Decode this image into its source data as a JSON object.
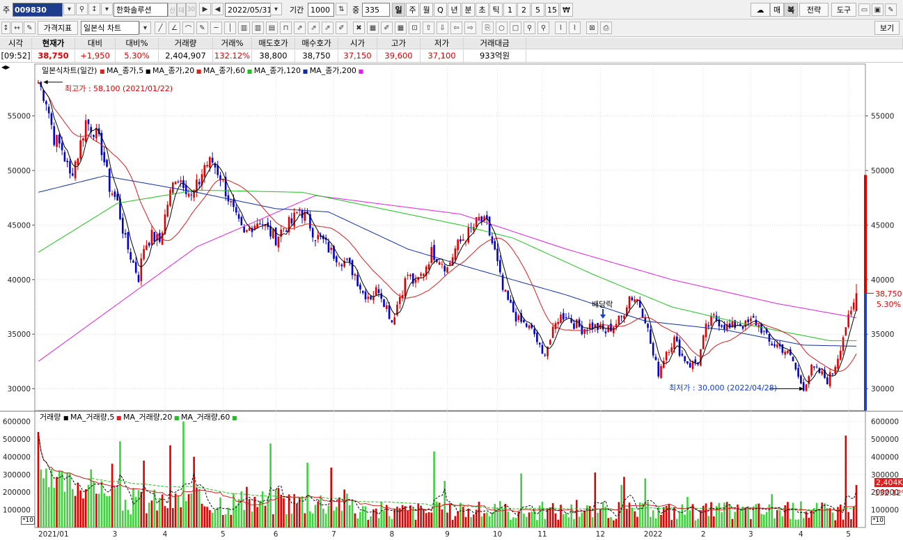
{
  "toolbar": {
    "market_label": "주",
    "stock_code": "009830",
    "stock_name": "한화솔루션",
    "badge1": "신",
    "badge2": "대",
    "badge3": "30",
    "date": "2022/05/31",
    "period_label": "기간",
    "period_value": "1000",
    "count_label": "중",
    "count_value": "335",
    "intervals": [
      "일",
      "주",
      "월",
      "Q",
      "년",
      "분",
      "초",
      "틱",
      "1",
      "2",
      "5",
      "15",
      "₩"
    ],
    "right_buttons": [
      "매",
      "복",
      "전략",
      "도구"
    ],
    "indicator_btn": "가격지표",
    "chart_type": "일본식 차트",
    "view_btn": "보기"
  },
  "quote": {
    "headers": [
      "시각",
      "현재가",
      "대비",
      "대비%",
      "거래량",
      "거래%",
      "매도호가",
      "매수호가",
      "시가",
      "고가",
      "저가",
      "거래대금"
    ],
    "values": [
      "[09:52]",
      "38,750",
      "+1,950",
      "5.30%",
      "2,404,907",
      "132.12%",
      "38,800",
      "38,750",
      "37,150",
      "39,600",
      "37,100",
      "933억원"
    ]
  },
  "price_panel": {
    "legend_title": "일본식차트(일간)",
    "ma": [
      {
        "label": "MA_종가,5",
        "color": "#e02020"
      },
      {
        "label": "MA_종가,20",
        "color": "#000000"
      },
      {
        "label": "MA_종가,60",
        "color": "#e02020"
      },
      {
        "label": "MA_종가,120",
        "color": "#20c020"
      },
      {
        "label": "MA_종가,200",
        "color": "#1030a0"
      }
    ],
    "ma_extra_color": "#e020e0",
    "high_note": "최고가 : 58,100 (2021/01/22)",
    "low_note": "최저가 : 30,000 (2022/04/28)",
    "dividend_note": "배당락",
    "last_price": "38,750",
    "last_pct": "5.30%"
  },
  "volume_panel": {
    "legend_title": "거래량",
    "ma": [
      {
        "label": "MA_거래량,5",
        "color": "#000000"
      },
      {
        "label": "MA_거래량,20",
        "color": "#e02020"
      },
      {
        "label": "MA_거래량,60",
        "color": "#20c020"
      }
    ],
    "last_volume": "2,404K",
    "last_pct": "132.12%",
    "scale_note": "*10"
  },
  "chart_data": {
    "type": "candlestick",
    "price_ylim": [
      28000,
      59500
    ],
    "price_ticks": [
      30000,
      35000,
      40000,
      45000,
      50000,
      55000
    ],
    "volume_ylim": [
      0,
      630000
    ],
    "volume_ticks": [
      100000,
      200000,
      300000,
      400000,
      500000,
      600000
    ],
    "x_ticks": [
      "2021/01",
      "3",
      "4",
      "5",
      "6",
      "7",
      "8",
      "9",
      "10",
      "11",
      "12",
      "2022",
      "2",
      "3",
      "4",
      "5"
    ],
    "price_anchors": [
      [
        0,
        58100
      ],
      [
        3,
        56500
      ],
      [
        6,
        53000
      ],
      [
        9,
        52000
      ],
      [
        12,
        49500
      ],
      [
        15,
        51500
      ],
      [
        18,
        54500
      ],
      [
        21,
        53800
      ],
      [
        24,
        52000
      ],
      [
        27,
        48500
      ],
      [
        30,
        47000
      ],
      [
        33,
        43500
      ],
      [
        36,
        41500
      ],
      [
        38,
        40200
      ],
      [
        40,
        43000
      ],
      [
        43,
        44000
      ],
      [
        46,
        43500
      ],
      [
        49,
        47000
      ],
      [
        52,
        49500
      ],
      [
        55,
        49000
      ],
      [
        58,
        47500
      ],
      [
        61,
        49000
      ],
      [
        63,
        50500
      ],
      [
        66,
        50800
      ],
      [
        69,
        49500
      ],
      [
        72,
        47500
      ],
      [
        75,
        45500
      ],
      [
        78,
        44000
      ],
      [
        81,
        45000
      ],
      [
        84,
        45500
      ],
      [
        87,
        44500
      ],
      [
        90,
        43800
      ],
      [
        93,
        44800
      ],
      [
        96,
        45200
      ],
      [
        99,
        46500
      ],
      [
        102,
        45500
      ],
      [
        105,
        44000
      ],
      [
        108,
        43500
      ],
      [
        111,
        42500
      ],
      [
        114,
        42000
      ],
      [
        117,
        41500
      ],
      [
        120,
        40500
      ],
      [
        123,
        38800
      ],
      [
        126,
        38500
      ],
      [
        129,
        39200
      ],
      [
        132,
        37500
      ],
      [
        134,
        36200
      ],
      [
        137,
        38500
      ],
      [
        140,
        40500
      ],
      [
        143,
        39500
      ],
      [
        146,
        40800
      ],
      [
        149,
        42500
      ],
      [
        152,
        42000
      ],
      [
        155,
        41000
      ],
      [
        158,
        42800
      ],
      [
        161,
        43800
      ],
      [
        164,
        44500
      ],
      [
        167,
        45500
      ],
      [
        170,
        45000
      ],
      [
        173,
        42500
      ],
      [
        176,
        39000
      ],
      [
        179,
        37500
      ],
      [
        182,
        36200
      ],
      [
        185,
        35800
      ],
      [
        188,
        35000
      ],
      [
        191,
        33000
      ],
      [
        194,
        34500
      ],
      [
        197,
        36500
      ],
      [
        200,
        36800
      ],
      [
        203,
        36000
      ],
      [
        206,
        35500
      ],
      [
        209,
        35800
      ],
      [
        212,
        35600
      ],
      [
        215,
        35200
      ],
      [
        218,
        35800
      ],
      [
        221,
        36500
      ],
      [
        224,
        38500
      ],
      [
        227,
        38200
      ],
      [
        230,
        36500
      ],
      [
        233,
        33000
      ],
      [
        235,
        31500
      ],
      [
        238,
        33500
      ],
      [
        241,
        34500
      ],
      [
        244,
        33000
      ],
      [
        247,
        32200
      ],
      [
        250,
        32500
      ],
      [
        253,
        35500
      ],
      [
        256,
        36500
      ],
      [
        259,
        36000
      ],
      [
        262,
        35500
      ],
      [
        265,
        36000
      ],
      [
        268,
        35800
      ],
      [
        271,
        36300
      ],
      [
        274,
        35500
      ],
      [
        277,
        34200
      ],
      [
        280,
        34000
      ],
      [
        283,
        33500
      ],
      [
        286,
        32500
      ],
      [
        288,
        31000
      ],
      [
        290,
        30200
      ],
      [
        293,
        31800
      ],
      [
        296,
        31500
      ],
      [
        299,
        30800
      ],
      [
        301,
        31500
      ],
      [
        303,
        33000
      ],
      [
        306,
        35800
      ],
      [
        308,
        36800
      ],
      [
        310,
        38750
      ]
    ],
    "ma200_anchors": [
      [
        0,
        32500
      ],
      [
        60,
        43000
      ],
      [
        105,
        47700
      ],
      [
        160,
        46000
      ],
      [
        200,
        42800
      ],
      [
        240,
        40000
      ],
      [
        280,
        37800
      ],
      [
        310,
        36500
      ]
    ],
    "ma120_anchors": [
      [
        0,
        48000
      ],
      [
        25,
        49500
      ],
      [
        60,
        48000
      ],
      [
        90,
        46500
      ],
      [
        110,
        46200
      ],
      [
        140,
        42800
      ],
      [
        165,
        41000
      ],
      [
        200,
        38600
      ],
      [
        230,
        36200
      ],
      [
        260,
        35400
      ],
      [
        290,
        34000
      ],
      [
        310,
        33900
      ]
    ],
    "ma60_anchors": [
      [
        0,
        42500
      ],
      [
        30,
        47000
      ],
      [
        60,
        48200
      ],
      [
        100,
        48000
      ],
      [
        130,
        46500
      ],
      [
        160,
        45000
      ],
      [
        180,
        43800
      ],
      [
        210,
        40500
      ],
      [
        240,
        37500
      ],
      [
        270,
        35800
      ],
      [
        300,
        34400
      ],
      [
        310,
        34400
      ]
    ]
  }
}
